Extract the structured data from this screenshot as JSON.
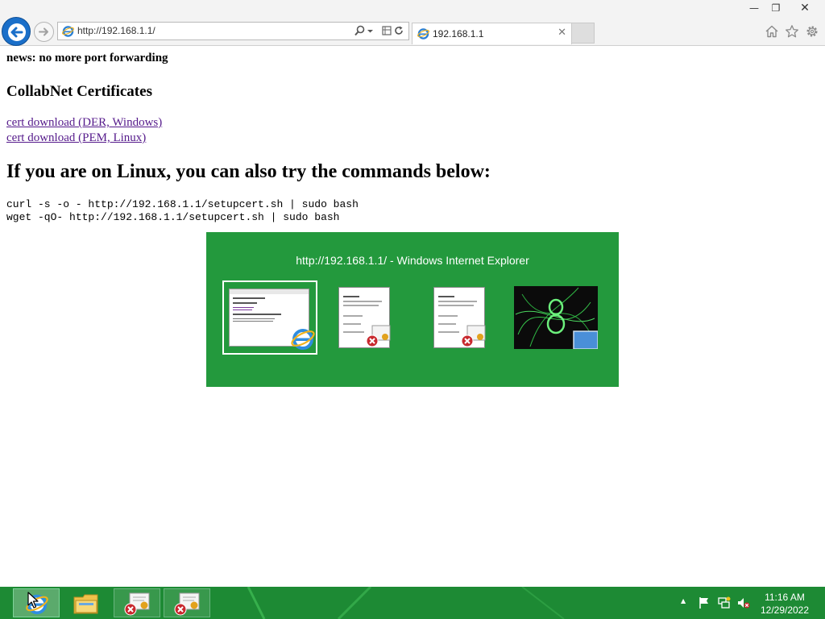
{
  "window": {
    "minimize_glyph": "—",
    "maximize_glyph": "❐",
    "close_glyph": "✕"
  },
  "browser": {
    "address_url": "http://192.168.1.1/",
    "tab_title": "192.168.1.1",
    "tab_close_glyph": "✕",
    "icons": [
      "back-arrow-icon",
      "forward-arrow-icon",
      "ie-page-icon",
      "search-icon",
      "dropdown-icon",
      "compatibility-icon",
      "refresh-icon",
      "home-icon",
      "favorites-star-icon",
      "tools-gear-icon"
    ]
  },
  "page": {
    "news": "news: no more port forwarding",
    "cert_heading": "CollabNet Certificates",
    "links": [
      {
        "label": "cert download (DER, Windows)"
      },
      {
        "label": "cert download (PEM, Linux)"
      }
    ],
    "linux_heading": "If you are on Linux, you can also try the commands below:",
    "commands": [
      "curl -s -o - http://192.168.1.1/setupcert.sh | sudo bash",
      "wget -qO- http://192.168.1.1/setupcert.sh | sudo bash"
    ],
    "link_color": "#551a8b"
  },
  "task_switcher": {
    "title": "http://192.168.1.1/ - Windows Internet Explorer",
    "background_color": "#23993d",
    "items": [
      {
        "name": "ie-window",
        "selected": true
      },
      {
        "name": "certificate-window-1",
        "selected": false
      },
      {
        "name": "certificate-window-2",
        "selected": false
      },
      {
        "name": "desktop",
        "selected": false
      }
    ]
  },
  "taskbar": {
    "color": "#1d8a34",
    "buttons": [
      "internet-explorer",
      "file-explorer",
      "certificate-1",
      "certificate-2"
    ],
    "tray_icons": [
      "show-hidden-icons-icon",
      "action-center-flag-icon",
      "network-icon",
      "volume-muted-icon"
    ],
    "show_hidden_glyph": "▲",
    "time": "11:16 AM",
    "date": "12/29/2022"
  }
}
